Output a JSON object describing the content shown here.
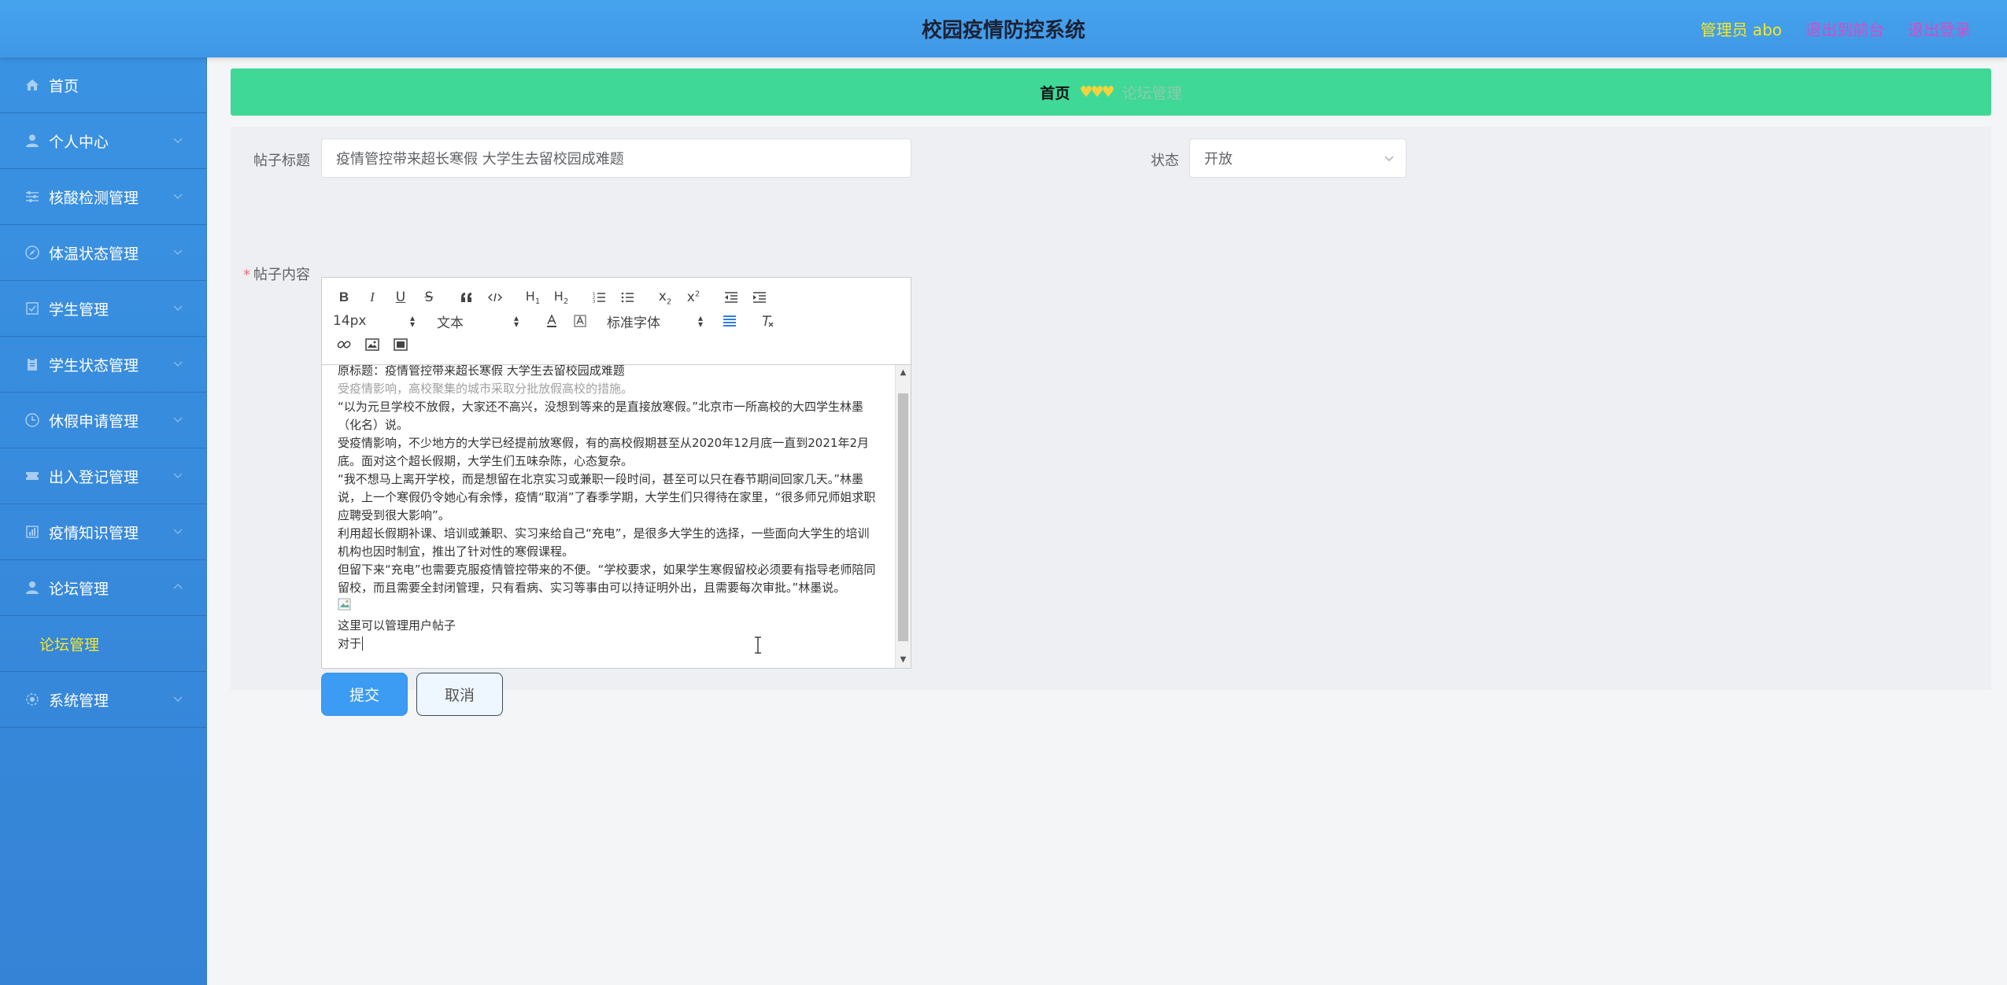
{
  "header": {
    "title": "校园疫情防控系统",
    "admin_label": "管理员 abo",
    "back_to_front": "退出到前台",
    "logout": "退出登录"
  },
  "colors": {
    "header_bg": "#409eff",
    "sidebar_bg": "#3a92e2",
    "accent_yellow": "#f5e72a",
    "link_magenta": "#d44cc9",
    "breadcrumb_bg": "#3fd897",
    "primary_button": "#3c9bf3"
  },
  "sidebar": {
    "items": [
      {
        "label": "首页",
        "icon": "home-icon"
      },
      {
        "label": "个人中心",
        "icon": "user-icon"
      },
      {
        "label": "核酸检测管理",
        "icon": "sliders-icon"
      },
      {
        "label": "体温状态管理",
        "icon": "compass-icon"
      },
      {
        "label": "学生管理",
        "icon": "checkbox-icon"
      },
      {
        "label": "学生状态管理",
        "icon": "clipboard-icon"
      },
      {
        "label": "休假申请管理",
        "icon": "clock-icon"
      },
      {
        "label": "出入登记管理",
        "icon": "ticket-icon"
      },
      {
        "label": "疫情知识管理",
        "icon": "chart-icon"
      },
      {
        "label": "论坛管理",
        "icon": "user-icon"
      },
      {
        "label": "系统管理",
        "icon": "settings-icon"
      }
    ],
    "sub_active": "论坛管理"
  },
  "breadcrumb": {
    "home": "首页",
    "separator": "♥♥♥",
    "current": "论坛管理"
  },
  "form": {
    "title_label": "帖子标题",
    "title_value": "疫情管控带来超长寒假 大学生去留校园成难题",
    "status_label": "状态",
    "status_value": "开放",
    "content_label": "帖子内容",
    "required_mark": "*",
    "submit": "提交",
    "cancel": "取消"
  },
  "editor": {
    "font_size": "14px",
    "block_format": "文本",
    "font_family": "标准字体",
    "paragraphs": [
      "原标题：疫情管控带来超长寒假 大学生去留校园成难题",
      "受疫情影响，高校聚集的城市采取分批放假高校的措施。",
      "“以为元旦学校不放假，大家还不高兴，没想到等来的是直接放寒假。”北京市一所高校的大四学生林墨（化名）说。",
      "受疫情影响，不少地方的大学已经提前放寒假，有的高校假期甚至从2020年12月底一直到2021年2月底。面对这个超长假期，大学生们五味杂陈，心态复杂。",
      "“我不想马上离开学校，而是想留在北京实习或兼职一段时间，甚至可以只在春节期间回家几天。”林墨说，上一个寒假仍令她心有余悸，疫情“取消”了春季学期，大学生们只得待在家里，“很多师兄师姐求职应聘受到很大影响”。",
      "利用超长假期补课、培训或兼职、实习来给自己“充电”，是很多大学生的选择，一些面向大学生的培训机构也因时制宜，推出了针对性的寒假课程。",
      "但留下来“充电”也需要克服疫情管控带来的不便。“学校要求，如果学生寒假留校必须要有指导老师陪同留校，而且需要全封闭管理，只有看病、实习等事由可以持证明外出，且需要每次审批。”林墨说。",
      "这里可以管理用户帖子",
      "对于"
    ]
  }
}
